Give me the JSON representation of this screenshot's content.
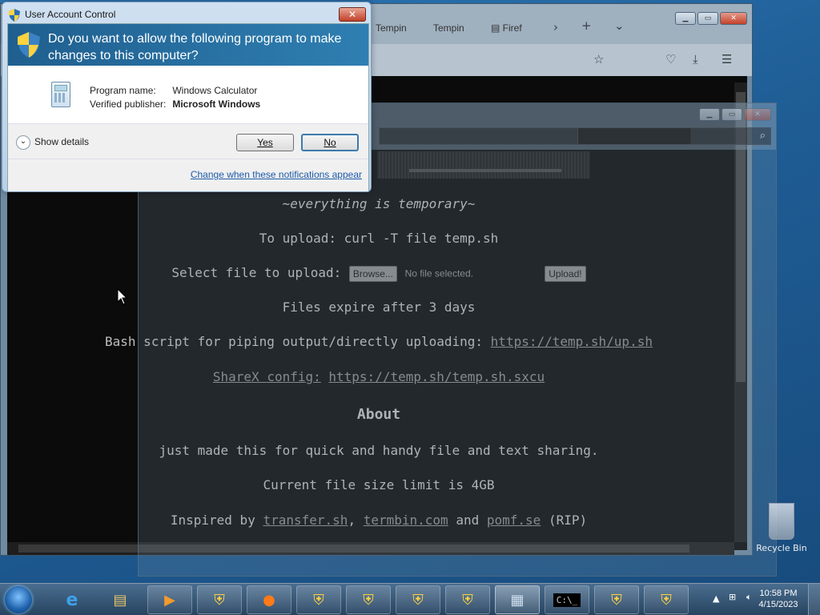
{
  "browser": {
    "tabs": [
      "Tempin",
      "Tempin",
      "Firef"
    ],
    "content": {
      "tagline": "~everything is temporary~",
      "upload_cmd": "To upload: curl -T file temp.sh",
      "select_label": "Select file to upload:",
      "browse_label": "Browse...",
      "no_file": "No file selected.",
      "upload_btn": "Upload!",
      "expire": "Files expire after 3 days",
      "bash_prefix": "Bash script for piping output/directly uploading:",
      "bash_link": "https://temp.sh/up.sh",
      "sharex_label": "ShareX config:",
      "sharex_link": "https://temp.sh/temp.sh.sxcu",
      "about_heading": "About",
      "about_text": "just made this for quick and handy file and text sharing.",
      "size_limit": "Current file size limit is 4GB",
      "inspired_prefix": "Inspired by",
      "link_transfer": "transfer.sh",
      "comma": ",",
      "link_termbin": "termbin.com",
      "and": "and",
      "link_pomf": "pomf.se",
      "rip": "(RIP)"
    }
  },
  "uac": {
    "title": "User Account Control",
    "question": "Do you want to allow the following program to make changes to this computer?",
    "program_label": "Program name:",
    "program_value": "Windows Calculator",
    "publisher_label": "Verified publisher:",
    "publisher_value": "Microsoft Windows",
    "details_label": "Show details",
    "yes_label": "Yes",
    "no_label": "No",
    "footer_link": "Change when these notifications appear",
    "close_label": "✕"
  },
  "desktop": {
    "recycle_bin_label": "Recycle Bin"
  },
  "taskbar": {
    "clock_time": "10:58 PM",
    "clock_date": "4/15/2023"
  },
  "colors": {
    "uac_banner": "#1f5f8f",
    "page_bg": "#0b0b0b",
    "link": "#8a8a8a"
  }
}
